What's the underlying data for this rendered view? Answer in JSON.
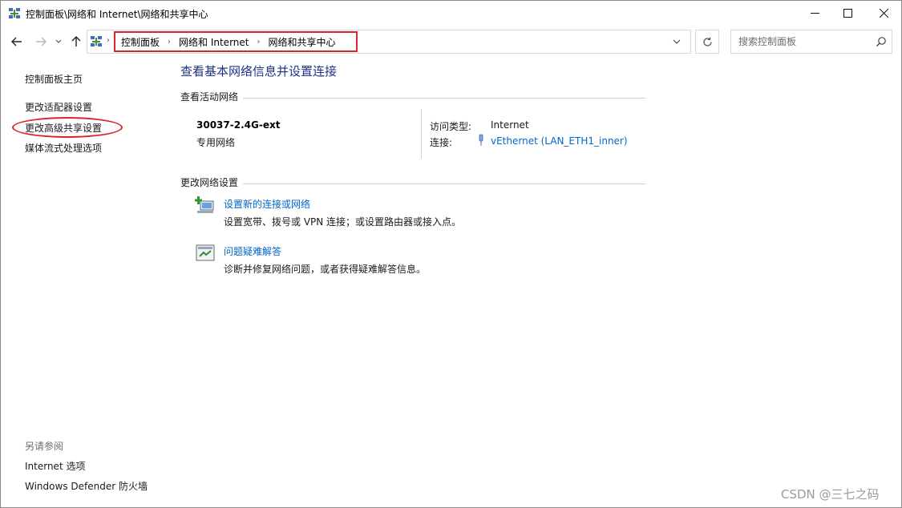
{
  "window": {
    "title": "控制面板\\网络和 Internet\\网络和共享中心",
    "controls": {
      "minimize_icon": "minimize-icon",
      "maximize_icon": "maximize-icon",
      "close_icon": "close-icon"
    }
  },
  "address": {
    "crumbs": [
      "控制面板",
      "网络和 Internet",
      "网络和共享中心"
    ],
    "highlight_color": "#d9262c"
  },
  "search": {
    "placeholder": "搜索控制面板"
  },
  "sidebar": {
    "home": "控制面板主页",
    "items": [
      "更改适配器设置",
      "更改高级共享设置",
      "媒体流式处理选项"
    ],
    "see_also_label": "另请参阅",
    "see_also": [
      "Internet 选项",
      "Windows Defender 防火墙"
    ]
  },
  "main": {
    "title": "查看基本网络信息并设置连接",
    "active_section": "查看活动网络",
    "network": {
      "name": "30037-2.4G-ext",
      "type": "专用网络",
      "access_label": "访问类型:",
      "access_value": "Internet",
      "connection_label": "连接:",
      "connection_value": "vEthernet (LAN_ETH1_inner)"
    },
    "change_section": "更改网络设置",
    "tasks": [
      {
        "link": "设置新的连接或网络",
        "desc": "设置宽带、拨号或 VPN 连接；或设置路由器或接入点。",
        "icon": "new-connection-icon"
      },
      {
        "link": "问题疑难解答",
        "desc": "诊断并修复网络问题，或者获得疑难解答信息。",
        "icon": "troubleshoot-icon"
      }
    ]
  },
  "watermark": "CSDN @三七之码",
  "colors": {
    "title_blue": "#1e3287",
    "link_blue": "#0066cc",
    "annotation_red": "#d9262c"
  }
}
